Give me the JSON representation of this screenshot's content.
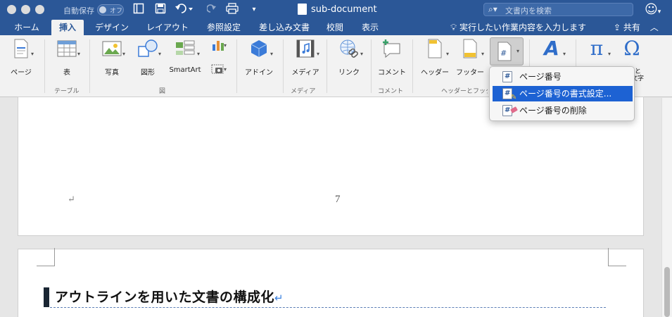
{
  "titlebar": {
    "autosave_label": "自動保存",
    "autosave_state": "オフ",
    "document_title": "sub-document",
    "search_placeholder": "文書内を検索"
  },
  "tabs": [
    "ホーム",
    "挿入",
    "デザイン",
    "レイアウト",
    "参照設定",
    "差し込み文書",
    "校閲",
    "表示"
  ],
  "active_tab": "挿入",
  "tell_me": "実行したい作業内容を入力します",
  "share": "共有",
  "ribbon": {
    "page_label": "ページ",
    "table_label": "表",
    "table_group": "テーブル",
    "picture_label": "写真",
    "shapes_label": "図形",
    "smartart_label": "SmartArt",
    "illustrations_group": "図",
    "addins_label": "アドイン",
    "media_label": "メディア",
    "media_group": "メディア",
    "link_label": "リンク",
    "comment_label": "コメント",
    "comment_group": "コメント",
    "header_label": "ヘッダー",
    "footer_label": "フッター",
    "headerfooter_group": "ヘッダーとフッター",
    "symbol_partial_1": "と",
    "symbol_partial_2": "文字"
  },
  "dropdown": {
    "items": [
      {
        "label": "ページ番号"
      },
      {
        "label": "ページ番号の書式設定..."
      },
      {
        "label": "ページ番号の削除"
      }
    ],
    "selected_index": 1
  },
  "document": {
    "page_number": "7",
    "heading": "アウトラインを用いた文書の構成化",
    "paragraph_mark": "↵"
  },
  "colors": {
    "title_bar": "#2b5797",
    "selection": "#1d62d3",
    "ribbon": "#f2f2f2"
  }
}
